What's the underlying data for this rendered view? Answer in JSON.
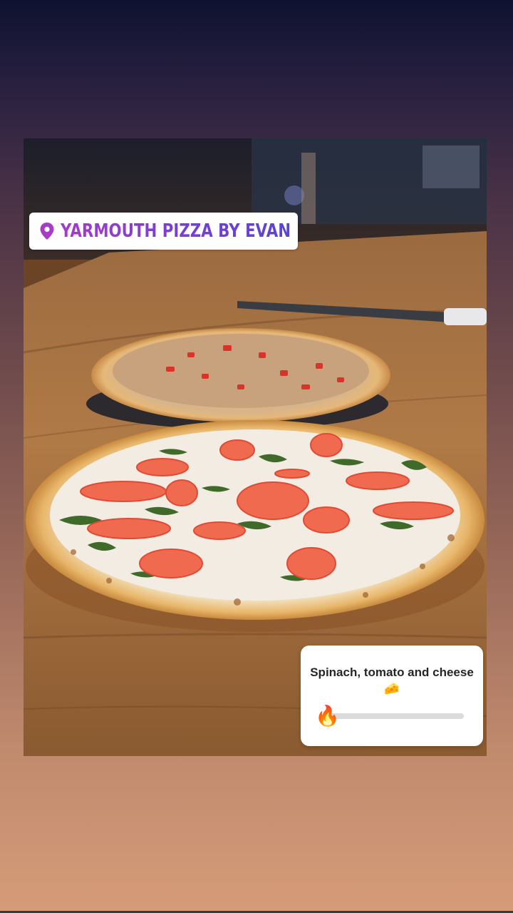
{
  "story": {
    "location_sticker": {
      "label": "YARMOUTH PIZZA BY EVAN",
      "icon": "location-pin-icon",
      "color": "#8a3dd0"
    },
    "slider_sticker": {
      "question": "Spinach, tomato and cheese 🧀",
      "emoji": "🔥",
      "level": 0
    }
  }
}
